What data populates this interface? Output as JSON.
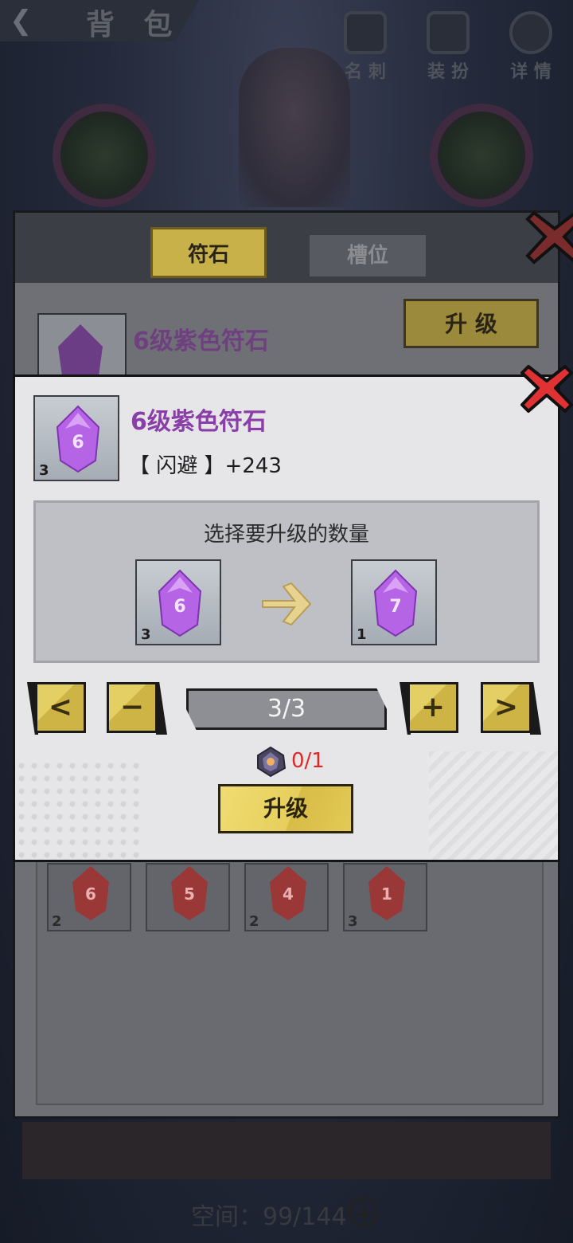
{
  "header": {
    "title": "背 包",
    "buttons": [
      {
        "label": "名 刺",
        "icon": "card-icon"
      },
      {
        "label": "装 扮",
        "icon": "costume-icon"
      },
      {
        "label": "详 情",
        "icon": "magnifier-icon"
      }
    ]
  },
  "background_dialog": {
    "tabs": [
      {
        "label": "符石",
        "active": true
      },
      {
        "label": "槽位",
        "active": false
      }
    ],
    "item": {
      "name": "6级紫色符石",
      "level": "6"
    },
    "upgrade_label": "升 级",
    "grid_items": [
      {
        "level": "6",
        "count": "2"
      },
      {
        "level": "5",
        "count": ""
      },
      {
        "level": "4",
        "count": "2"
      },
      {
        "level": "1",
        "count": "3"
      }
    ]
  },
  "dialog": {
    "item": {
      "name": "6级紫色符石",
      "attribute": "【 闪避 】+243",
      "level": "6",
      "count": "3"
    },
    "select_title": "选择要升级的数量",
    "from": {
      "level": "6",
      "count": "3"
    },
    "to": {
      "level": "7",
      "count": "1"
    },
    "controls": {
      "prev": "<",
      "minus": "−",
      "quantity": "3/3",
      "plus": "+",
      "next": ">"
    },
    "cost": {
      "text": "0/1",
      "icon": "rune-stone-icon",
      "color": "#e0282a"
    },
    "upgrade_label": "升级"
  },
  "footer": {
    "space": "空间：99/144"
  },
  "colors": {
    "accent_gold": "#e4cc58",
    "purple_text": "#8a3fa8",
    "gem_purple": "#b564e6",
    "gem_red": "#a83a3a"
  }
}
